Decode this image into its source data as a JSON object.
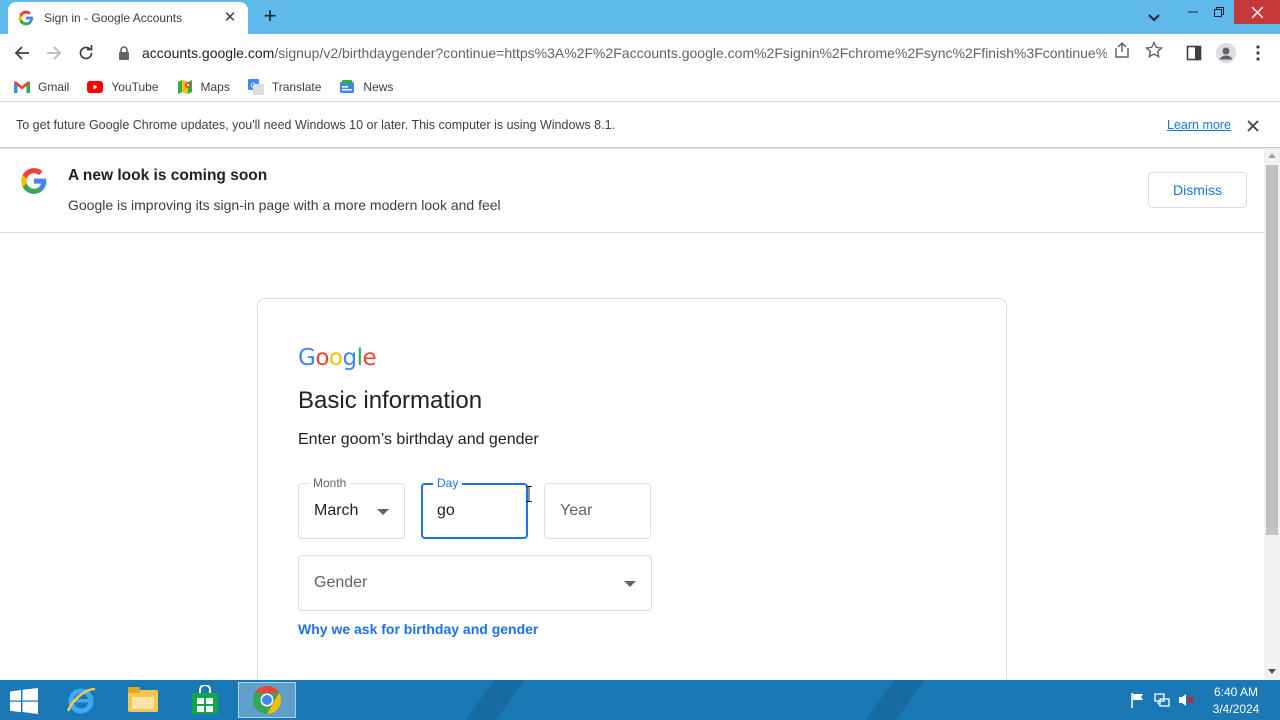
{
  "window": {
    "tab_title": "Sign in - Google Accounts",
    "tab_close": "✕",
    "new_tab": "+"
  },
  "toolbar": {
    "url_host": "accounts.google.com",
    "url_path": "/signup/v2/birthdaygender?continue=https%3A%2F%2Faccounts.google.com%2Fsignin%2Fchrome%2Fsync%2Ffinish%3Fcontinue%..."
  },
  "bookmarks": [
    {
      "label": "Gmail",
      "icon": "gmail-icon"
    },
    {
      "label": "YouTube",
      "icon": "youtube-icon"
    },
    {
      "label": "Maps",
      "icon": "maps-icon"
    },
    {
      "label": "Translate",
      "icon": "translate-icon"
    },
    {
      "label": "News",
      "icon": "news-icon"
    }
  ],
  "infobar": {
    "message": "To get future Google Chrome updates, you'll need Windows 10 or later. This computer is using Windows 8.1.",
    "learn_more": "Learn more"
  },
  "banner": {
    "title": "A new look is coming soon",
    "subtitle": "Google is improving its sign-in page with a more modern look and feel",
    "dismiss": "Dismiss"
  },
  "card": {
    "logo_letters": [
      "G",
      "o",
      "o",
      "g",
      "l",
      "e"
    ],
    "logo_colors": [
      "#4285f4",
      "#ea4335",
      "#fbbc05",
      "#4285f4",
      "#34a853",
      "#ea4335"
    ],
    "title": "Basic information",
    "subtitle": "Enter goom’s birthday and gender",
    "month": {
      "label": "Month",
      "value": "March"
    },
    "day": {
      "label": "Day",
      "value": "go"
    },
    "year": {
      "placeholder": "Year"
    },
    "gender": {
      "placeholder": "Gender"
    },
    "why_link": "Why we ask for birthday and gender"
  },
  "taskbar": {
    "time": "6:40 AM",
    "date": "3/4/2024"
  },
  "colors": {
    "accent": "#1a73e8",
    "titlebar": "#5fb9ea",
    "taskbar": "#1a78b4"
  }
}
